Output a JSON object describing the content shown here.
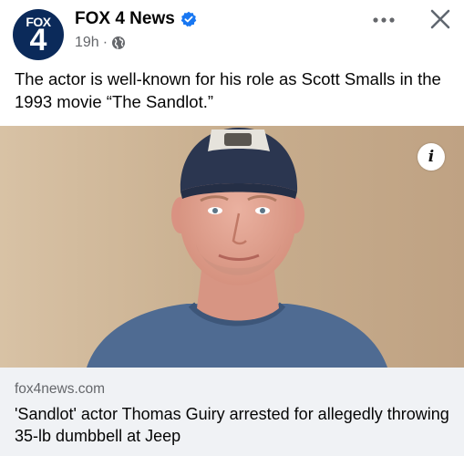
{
  "post": {
    "page_name": "FOX 4 News",
    "avatar_text_top": "FOX",
    "avatar_text_number": "4",
    "time": "19h",
    "separator": "·",
    "caption": "The actor is well-known for his role as Scott Smalls in the 1993 movie “The Sandlot.”"
  },
  "link_preview": {
    "domain": "fox4news.com",
    "headline": "'Sandlot' actor Thomas Guiry arrested for allegedly throwing 35-lb dumbbell at Jeep"
  },
  "icons": {
    "verified": "verified-badge-icon",
    "audience": "globe-icon",
    "more": "more-options-icon",
    "close": "close-icon",
    "info": "info-icon"
  },
  "colors": {
    "verified_blue": "#1877f2",
    "secondary_text": "#65676b",
    "link_box_bg": "#f0f2f5",
    "avatar_bg": "#0b2a5a"
  }
}
